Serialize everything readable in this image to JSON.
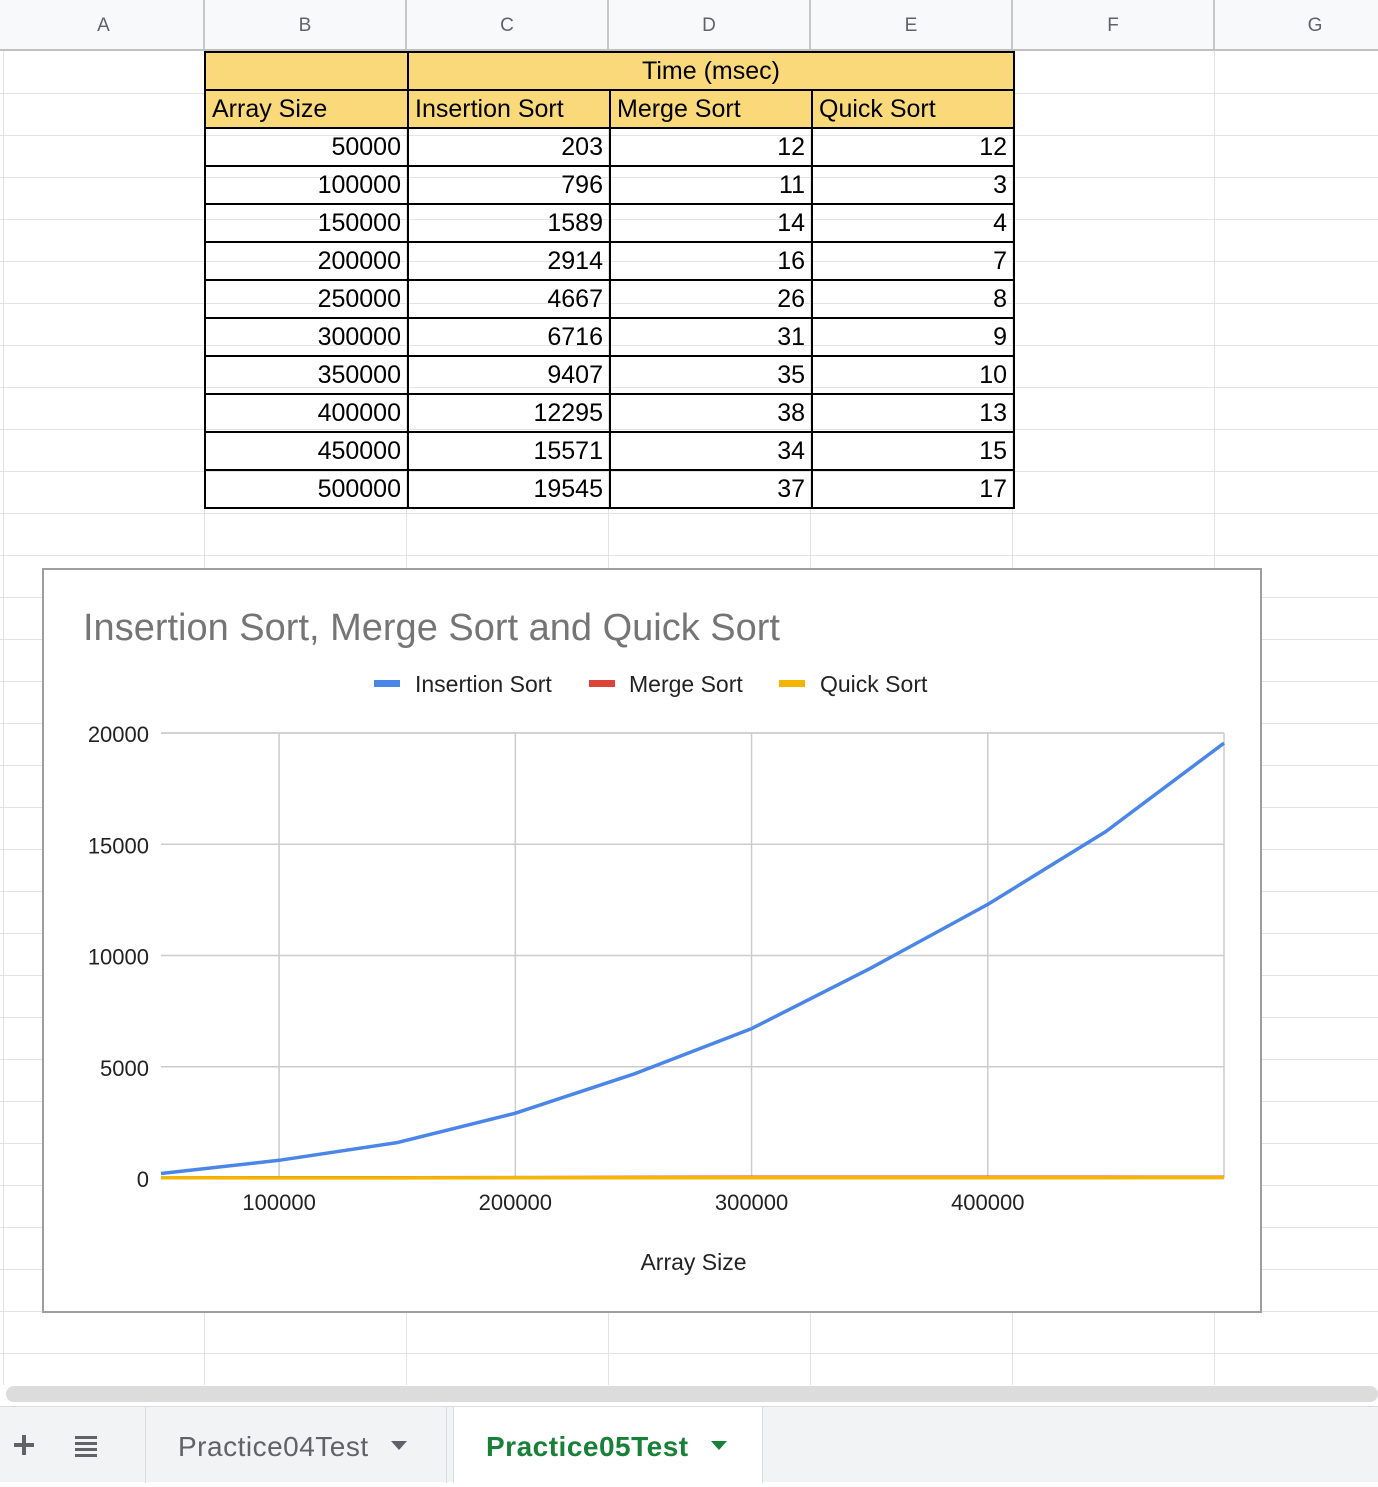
{
  "columns": [
    "A",
    "B",
    "C",
    "D",
    "E",
    "F",
    "G"
  ],
  "table": {
    "group_header": "Time (msec)",
    "headers": [
      "Array Size",
      "Insertion Sort",
      "Merge Sort",
      "Quick Sort"
    ],
    "rows": [
      [
        "50000",
        "203",
        "12",
        "12"
      ],
      [
        "100000",
        "796",
        "11",
        "3"
      ],
      [
        "150000",
        "1589",
        "14",
        "4"
      ],
      [
        "200000",
        "2914",
        "16",
        "7"
      ],
      [
        "250000",
        "4667",
        "26",
        "8"
      ],
      [
        "300000",
        "6716",
        "31",
        "9"
      ],
      [
        "350000",
        "9407",
        "35",
        "10"
      ],
      [
        "400000",
        "12295",
        "38",
        "13"
      ],
      [
        "450000",
        "15571",
        "34",
        "15"
      ],
      [
        "500000",
        "19545",
        "37",
        "17"
      ]
    ]
  },
  "chart_data": {
    "type": "line",
    "title": "Insertion Sort, Merge Sort and Quick Sort",
    "xlabel": "Array Size",
    "ylabel": "",
    "x": [
      50000,
      100000,
      150000,
      200000,
      250000,
      300000,
      350000,
      400000,
      450000,
      500000
    ],
    "series": [
      {
        "name": "Insertion Sort",
        "color": "#4a86e8",
        "values": [
          203,
          796,
          1589,
          2914,
          4667,
          6716,
          9407,
          12295,
          15571,
          19545
        ]
      },
      {
        "name": "Merge Sort",
        "color": "#db4437",
        "values": [
          12,
          11,
          14,
          16,
          26,
          31,
          35,
          38,
          34,
          37
        ]
      },
      {
        "name": "Quick Sort",
        "color": "#f4b400",
        "values": [
          12,
          3,
          4,
          7,
          8,
          9,
          10,
          13,
          15,
          17
        ]
      }
    ],
    "xlim": [
      50000,
      500000
    ],
    "ylim": [
      0,
      20000
    ],
    "xticks": [
      "100000",
      "200000",
      "300000",
      "400000"
    ],
    "yticks": [
      "0",
      "5000",
      "10000",
      "15000",
      "20000"
    ],
    "grid": true,
    "legend_position": "top"
  },
  "tabs": {
    "add_icon": "plus-icon",
    "list_icon": "all-sheets-icon",
    "items": [
      {
        "label": "Practice04Test",
        "active": false
      },
      {
        "label": "Practice05Test",
        "active": true
      }
    ],
    "active_color": "#188038"
  }
}
